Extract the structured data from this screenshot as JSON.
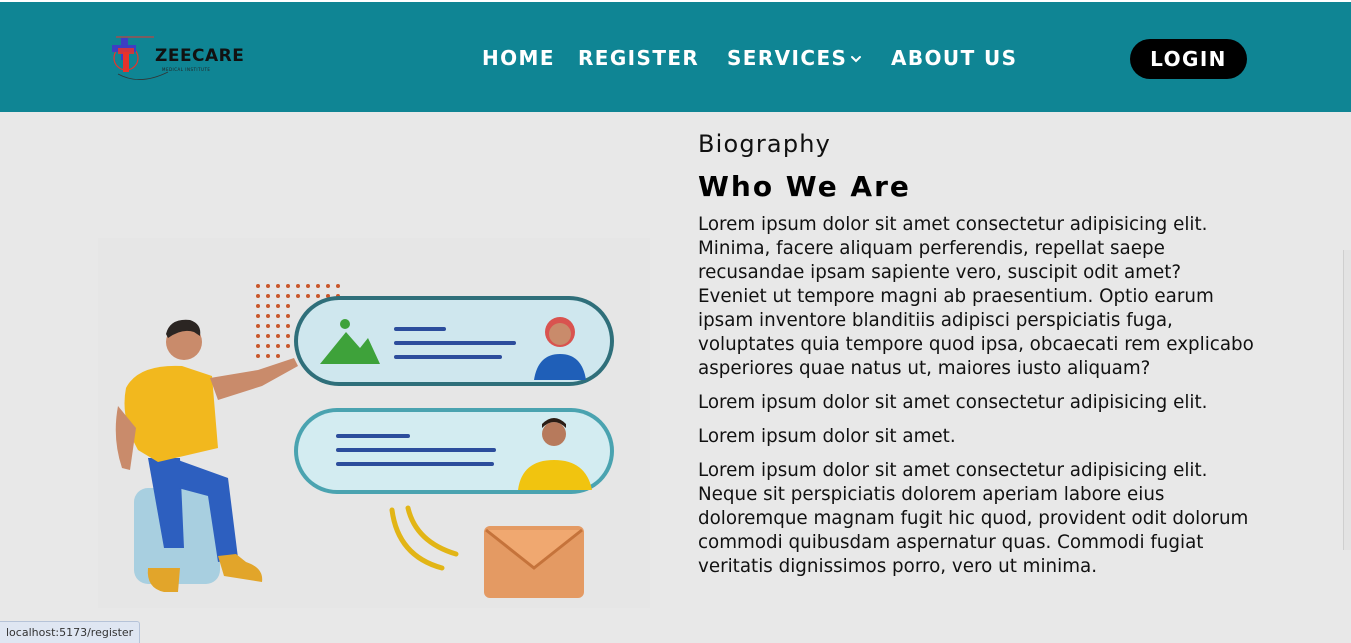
{
  "brand": {
    "name": "ZEECARE",
    "tagline": "MEDICAL INSTITUTE",
    "colors": {
      "navbar": "#0f8594",
      "login_button": "#000000",
      "cross_red": "#e8332b",
      "cross_blue": "#3d3ec4"
    }
  },
  "nav": {
    "items": [
      {
        "label": "HOME"
      },
      {
        "label": "REGISTER"
      },
      {
        "label": "SERVICES",
        "icon": "chevron-down-icon"
      },
      {
        "label": "ABOUT US"
      }
    ],
    "login_label": "LOGIN"
  },
  "main": {
    "section_label": "Biography",
    "title": "Who We Are",
    "paragraphs": [
      "Lorem ipsum dolor sit amet consectetur adipisicing elit. Minima, facere aliquam perferendis, repellat saepe recusandae ipsam sapiente vero, suscipit odit amet? Eveniet ut tempore magni ab praesentium. Optio earum ipsam inventore blanditiis adipisci perspiciatis fuga, voluptates quia tempore quod ipsa, obcaecati rem explicabo asperiores quae natus ut, maiores iusto aliquam?",
      "Lorem ipsum dolor sit amet consectetur adipisicing elit.",
      "Lorem ipsum dolor sit amet.",
      "Lorem ipsum dolor sit amet consectetur adipisicing elit. Neque sit perspiciatis dolorem aperiam labore eius doloremque magnam fugit hic quod, provident odit dolorum commodi quibusdam aspernatur quas. Commodi fugiat veritatis dignissimos porro, vero ut minima."
    ]
  },
  "status_bar": {
    "url": "localhost:5173/register"
  }
}
